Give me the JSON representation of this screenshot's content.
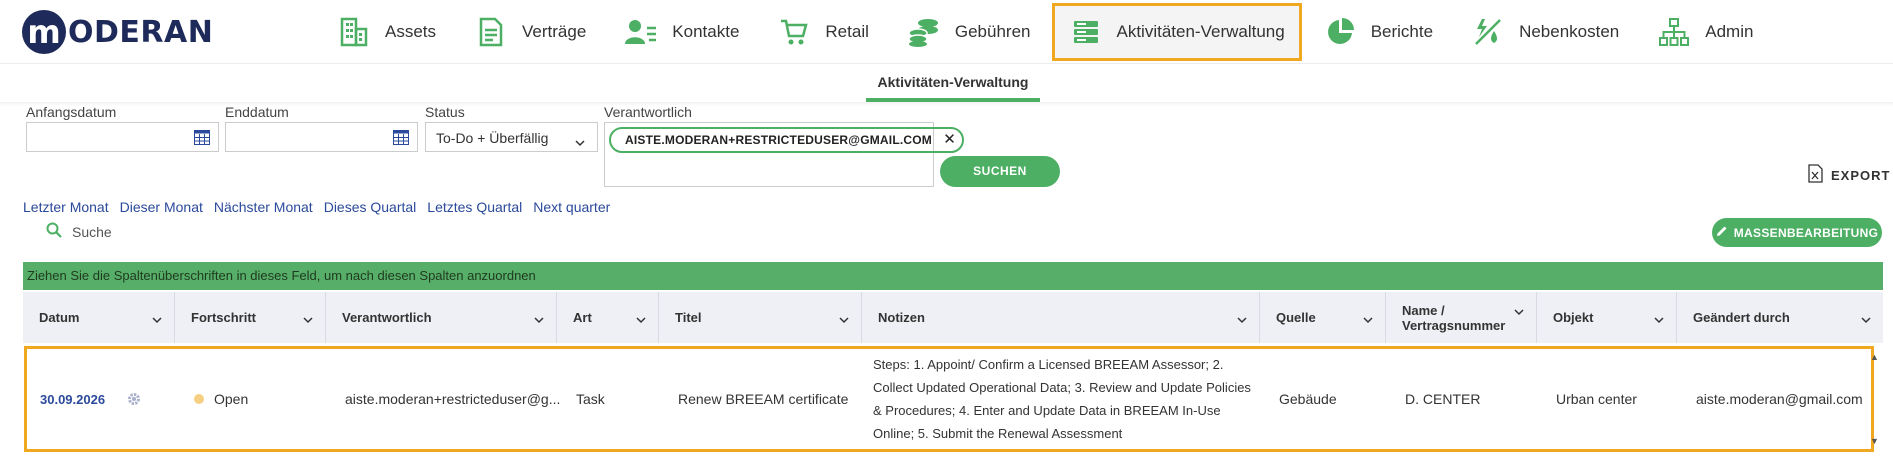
{
  "app": {
    "logo_letter": "m",
    "logo_text": "ODERAN",
    "brand_color": "#1e2b5a",
    "accent_color": "#4caf63",
    "highlight_color": "#f0a820"
  },
  "nav": {
    "items": [
      {
        "label": "Assets",
        "icon": "buildings-icon"
      },
      {
        "label": "Verträge",
        "icon": "document-icon"
      },
      {
        "label": "Kontakte",
        "icon": "contacts-icon"
      },
      {
        "label": "Retail",
        "icon": "cart-icon"
      },
      {
        "label": "Gebühren",
        "icon": "coins-icon"
      },
      {
        "label": "Aktivitäten-Verwaltung",
        "icon": "server-list-icon"
      },
      {
        "label": "Berichte",
        "icon": "pie-chart-icon"
      },
      {
        "label": "Nebenkosten",
        "icon": "utilities-icon"
      },
      {
        "label": "Admin",
        "icon": "org-chart-icon"
      }
    ],
    "active": "Aktivitäten-Verwaltung"
  },
  "subnav": {
    "tab": "Aktivitäten-Verwaltung"
  },
  "filters": {
    "start_label": "Anfangsdatum",
    "start_value": "",
    "end_label": "Enddatum",
    "end_value": "",
    "status_label": "Status",
    "status_value": "To-Do + Überfällig",
    "responsible_label": "Verantwortlich",
    "responsible_chip": "AISTE.MODERAN+RESTRICTEDUSER@GMAIL.COM",
    "search_button": "SUCHEN",
    "export_label": "EXPORT"
  },
  "quick_filters": [
    "Letzter Monat",
    "Dieser Monat",
    "Nächster Monat",
    "Dieses Quartal",
    "Letztes Quartal",
    "Next quarter"
  ],
  "search": {
    "label": "Suche"
  },
  "mass_edit": {
    "label": "MASSENBEARBEITUNG"
  },
  "grid": {
    "group_hint": "Ziehen Sie die Spaltenüberschriften in dieses Feld, um nach diesen Spalten anzuordnen",
    "columns": [
      "Datum",
      "Fortschritt",
      "Verantwortlich",
      "Art",
      "Titel",
      "Notizen",
      "Quelle",
      "Name / Vertragsnummer",
      "Objekt",
      "Geändert durch"
    ],
    "rows": [
      {
        "date": "30.09.2026",
        "progress": "Open",
        "responsible": "aiste.moderan+restricteduser@g...",
        "type": "Task",
        "title": "Renew BREEAM certificate",
        "notes": "Steps: 1. Appoint/ Confirm a Licensed BREEAM Assessor; 2. Collect Updated Operational Data; 3. Review and Update Policies & Procedures; 4. Enter and Update Data in BREEAM In-Use Online; 5. Submit the Renewal Assessment",
        "source": "Gebäude",
        "name": "D. CENTER",
        "object": "Urban center",
        "changed_by": "aiste.moderan@gmail.com"
      }
    ]
  }
}
